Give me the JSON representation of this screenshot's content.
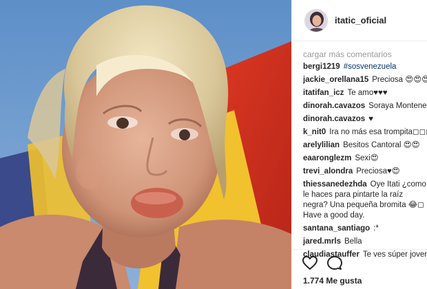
{
  "post": {
    "username": "itatic_oficial",
    "load_more_label": "cargar más comentarios",
    "comments": [
      {
        "user": "bergi1219",
        "text": "#sosvenezuela",
        "tag": true
      },
      {
        "user": "jackie_orellana15",
        "text": "Preciosa 😍😍😍😍"
      },
      {
        "user": "itatifan_icz",
        "text": "Te amo♥♥♥"
      },
      {
        "user": "dinorah.cavazos",
        "text": "Soraya Montenegro"
      },
      {
        "user": "dinorah.cavazos",
        "text": "♥"
      },
      {
        "user": "k_nit0",
        "text": "Ira no más esa trompita◻◻◻◻"
      },
      {
        "user": "arelylilian",
        "text": "Besitos Cantoral 😍😍"
      },
      {
        "user": "eaaronglezm",
        "text": "Sexi😍"
      },
      {
        "user": "trevi_alondra",
        "text": "Preciosa♥😍"
      },
      {
        "user": "thiessanedezhda",
        "text": "Oye Itati ¿como le haces para pintarte la raíz negra? Una pequeña bromita 😂◻ Have a good day.",
        "multi": true
      },
      {
        "user": "santana_santiago",
        "text": ":*"
      },
      {
        "user": "jared.mrls",
        "text": "Bella"
      },
      {
        "user": "claudiastauffer",
        "text": "Te ves súper joven se"
      }
    ],
    "likes": "1.774 Me gusta",
    "icons": {
      "like": "heart-icon",
      "comment": "comment-bubble-icon"
    }
  }
}
